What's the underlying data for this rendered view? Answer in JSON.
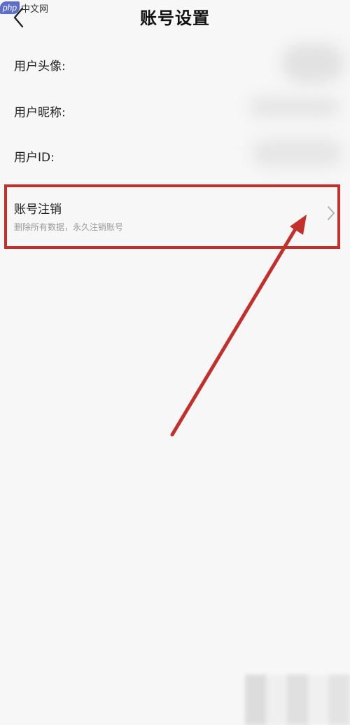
{
  "watermark": {
    "badge": "php",
    "text": "中文网"
  },
  "header": {
    "title": "账号设置",
    "back_icon": "chevron-left-icon"
  },
  "rows": {
    "avatar_label": "用户头像:",
    "nickname_label": "用户昵称:",
    "userid_label": "用户ID:"
  },
  "cancel_account": {
    "title": "账号注销",
    "subtitle": "删除所有数据，永久注销账号",
    "chevron_icon": "chevron-right-icon"
  },
  "colors": {
    "background": "#f7f7f7",
    "highlight": "#c3302b",
    "subtitle_text": "#9a9a9a"
  }
}
